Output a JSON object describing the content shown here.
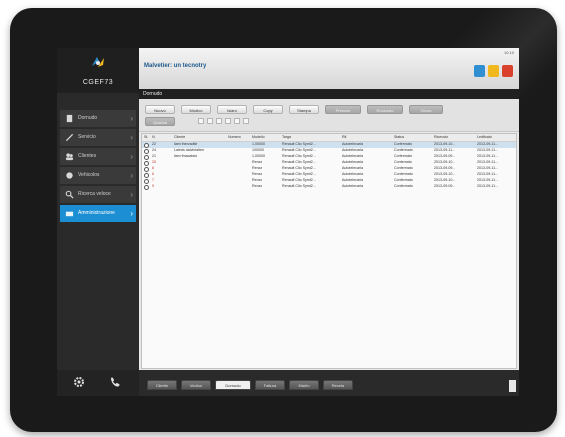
{
  "app": {
    "logo_text": "CGEF73",
    "time": "10:10",
    "window_title": "Malvetier: un tecnotry",
    "toolbar_label": "Dornudo"
  },
  "nav": {
    "items": [
      {
        "label": "Dornudo",
        "icon": "document-icon",
        "active": false
      },
      {
        "label": "Servicio",
        "icon": "wrench-icon",
        "active": false
      },
      {
        "label": "Clientes",
        "icon": "users-icon",
        "active": false
      },
      {
        "label": "Vehicolos",
        "icon": "car-icon",
        "active": false
      },
      {
        "label": "Ricerca veloce",
        "icon": "search-icon",
        "active": false
      },
      {
        "label": "Amministrazione",
        "icon": "folder-icon",
        "active": true
      }
    ]
  },
  "actions": {
    "row1": [
      "Nuovo",
      "Modico",
      "Islaro",
      "Copy",
      "Stampa",
      "Presoce",
      "Rocloudo",
      "Clicco"
    ],
    "row2": [
      "Quadrai"
    ]
  },
  "table": {
    "columns": [
      "St.",
      "N.",
      "Cliente",
      "Numero",
      "Modello",
      "Targa",
      "Rif.",
      "Status",
      "Ricevuto",
      "Ledtfcato"
    ],
    "rows": [
      {
        "icon": "status-icon",
        "c": [
          "",
          "22",
          "liam thervadtie",
          "",
          "1,00000",
          "Renault Clio Symt2...",
          "Autotelecaria",
          "Corfermato",
          "2013-09-10...",
          "2013-09-11..."
        ]
      },
      {
        "icon": "status-icon",
        "c": [
          "",
          "24",
          "Lateds dalvintalten",
          "",
          "100000",
          "Renault Clio Symt2...",
          "Autotelecaria",
          "Confermato",
          "2013-09-11...",
          "2013-09-11..."
        ]
      },
      {
        "icon": "status-icon",
        "c": [
          "",
          "21",
          "liam fmacatsto",
          "",
          "1,00000",
          "Renault Clio Symt2...",
          "Autotelecaria",
          "Corfermato",
          "2013-09-09...",
          "2013-09-11..."
        ]
      },
      {
        "icon": "status-icon",
        "c": [
          "",
          "25",
          "",
          "",
          "Renzz",
          "Renault Clio Symt2...",
          "Autotelecaria",
          "Confernato",
          "2013-09-10...",
          "2013-09-11..."
        ]
      },
      {
        "icon": "status-icon",
        "c": [
          "",
          "8",
          "",
          "",
          "Renzz",
          "Renault Clio Symt2...",
          "Autotelecaria",
          "Confermato",
          "2013-09-09...",
          "2013-09-11..."
        ]
      },
      {
        "icon": "status-icon",
        "c": [
          "",
          "6",
          "",
          "",
          "Renzz",
          "Renault Clio Symt2...",
          "Autotelecaria",
          "Confermato",
          "2013-09-10...",
          "2013-09-11..."
        ]
      },
      {
        "icon": "status-icon",
        "c": [
          "",
          "7",
          "",
          "",
          "Renzz",
          "Renault Clio Symt2...",
          "Autotelecaria",
          "Confermato",
          "2013-09-10...",
          "2013-09-11..."
        ]
      },
      {
        "icon": "status-icon",
        "c": [
          "",
          "5",
          "",
          "",
          "Renzz",
          "Renault Clio Symt2...",
          "Autotelecaria",
          "Confermato",
          "2013-09-09...",
          "2013-09-11..."
        ]
      }
    ]
  },
  "tabs": [
    "Cliertie",
    "Vediuo",
    "Dornudo",
    "Fatlura",
    "Marito",
    "Recela"
  ],
  "active_tab": 2,
  "colors": {
    "accent": "#1c8fd4",
    "header_btn_blue": "#2f8fd0",
    "header_btn_yellow": "#f0b81c",
    "header_btn_red": "#d9412c"
  }
}
